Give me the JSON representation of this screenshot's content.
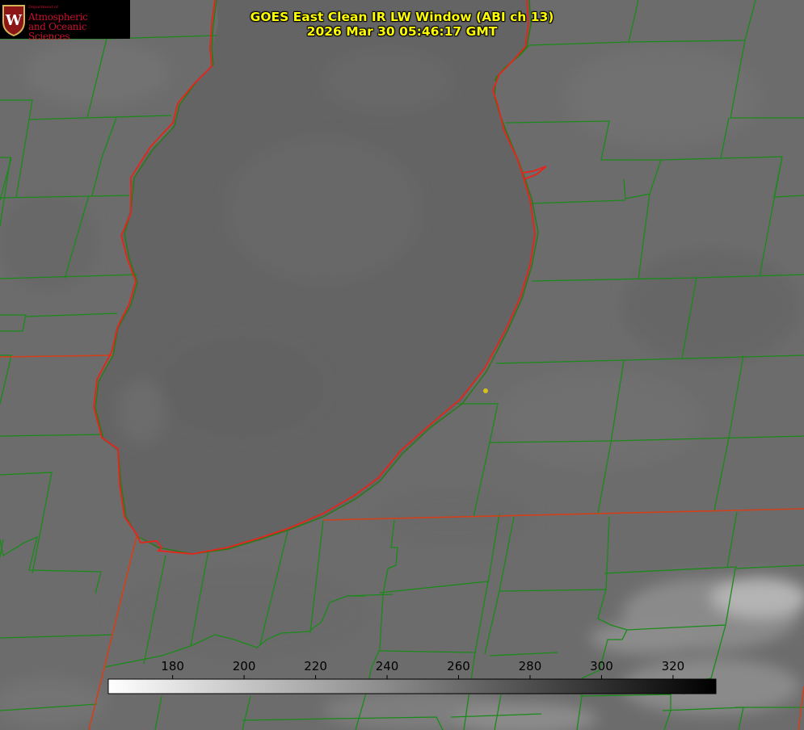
{
  "title": {
    "line1": "GOES East Clean IR LW Window (ABI ch 13)",
    "line2": "2026 Mar 30 05:46:17 GMT"
  },
  "logo": {
    "department": "Department of",
    "line1": "Atmospheric",
    "line2": "and Oceanic Sciences",
    "seal_letter": "W"
  },
  "colorbar": {
    "ticks": [
      "180",
      "200",
      "220",
      "240",
      "260",
      "280",
      "300",
      "320"
    ],
    "tick_values": [
      180,
      200,
      220,
      240,
      260,
      280,
      300,
      320
    ],
    "range": [
      162,
      332
    ],
    "gradient": "white-to-black"
  },
  "colors": {
    "county_lines": "#1a8a1a",
    "state_lines": "#d2401a",
    "shoreline": "#e8231a",
    "title_text": "#ffff00",
    "marker": "#d4c21a",
    "logo_red": "#c8102e"
  }
}
